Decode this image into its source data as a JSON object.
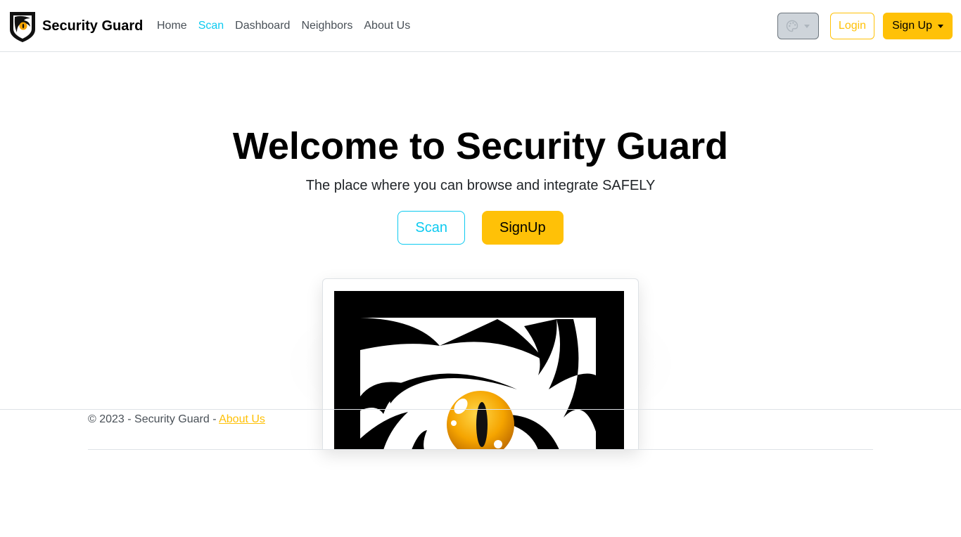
{
  "brand": {
    "name": "Security Guard",
    "logo_icon": "shield-eye-logo-icon"
  },
  "nav": {
    "items": [
      {
        "label": "Home",
        "active": false
      },
      {
        "label": "Scan",
        "active": true
      },
      {
        "label": "Dashboard",
        "active": false
      },
      {
        "label": "Neighbors",
        "active": false
      },
      {
        "label": "About Us",
        "active": false
      }
    ]
  },
  "actions": {
    "theme_icon": "palette-icon",
    "login_label": "Login",
    "signup_label": "Sign Up"
  },
  "hero": {
    "title": "Welcome to Security Guard",
    "subtitle": "The place where you can browse and integrate SAFELY",
    "scan_label": "Scan",
    "signup_label": "SignUp"
  },
  "hero_image": {
    "icon": "eye-logo-icon"
  },
  "footer": {
    "copyright": "© 2023 - Security Guard - ",
    "about_label": "About Us"
  },
  "colors": {
    "accent_info": "#0dcaf0",
    "accent_warning": "#ffc107",
    "eye_orange": "#f5a400"
  }
}
